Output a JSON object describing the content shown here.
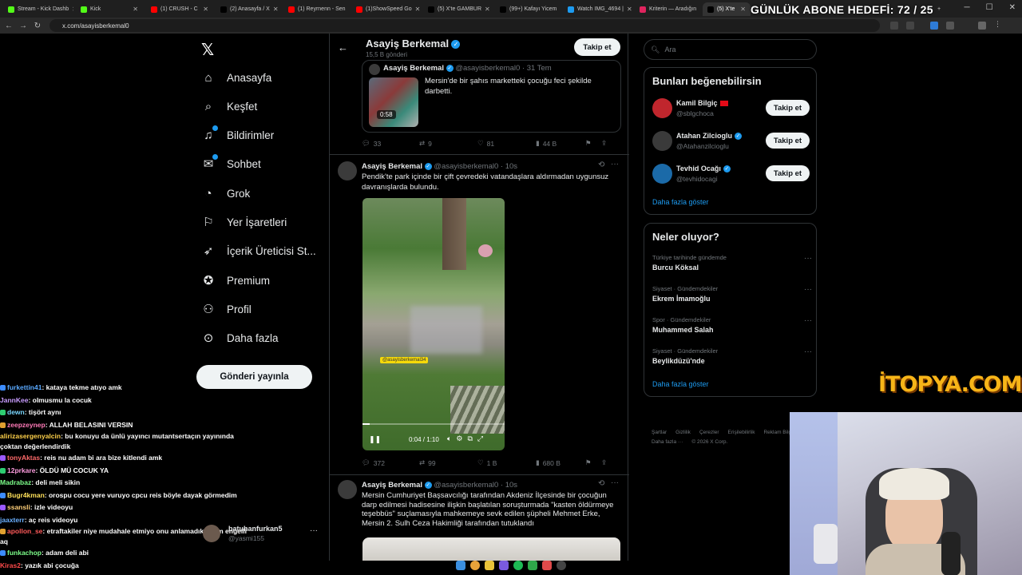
{
  "browser": {
    "tabs": [
      {
        "label": "Stream - Kick Dashb",
        "color": "#53fc18"
      },
      {
        "label": "Kick",
        "color": "#53fc18"
      },
      {
        "label": "(1) CRUSH - C",
        "color": "#ff0000"
      },
      {
        "label": "(2) Anasayfa / X",
        "color": "#000000"
      },
      {
        "label": "(1) Reyrnenn - Sen",
        "color": "#ff0000"
      },
      {
        "label": "(1)ShowSpeed Go",
        "color": "#ff0000"
      },
      {
        "label": "(5) X'te GAMBUR",
        "color": "#000000"
      },
      {
        "label": "(99+) Kafayı Yicem",
        "color": "#000000"
      },
      {
        "label": "Watch IMG_4694 |",
        "color": "#1d9bf0"
      },
      {
        "label": "Kriterin — Aradığın",
        "color": "#e0245e"
      },
      {
        "label": "(5) X'te",
        "color": "#000000"
      }
    ],
    "url": "x.com/asayisberkemal0"
  },
  "overlay": {
    "goal": "GÜNLÜK ABONE HEDEFİ: 72 / 25",
    "sponsor": "İTOPYA.COM"
  },
  "nav": {
    "items": [
      {
        "label": "Anasayfa",
        "icon": "home-icon"
      },
      {
        "label": "Keşfet",
        "icon": "search-icon"
      },
      {
        "label": "Bildirimler",
        "icon": "bell-icon"
      },
      {
        "label": "Sohbet",
        "icon": "chat-icon"
      },
      {
        "label": "Grok",
        "icon": "grok-icon"
      },
      {
        "label": "Yer İşaretleri",
        "icon": "bookmark-icon"
      },
      {
        "label": "İçerik Üreticisi St...",
        "icon": "rocket-icon"
      },
      {
        "label": "Premium",
        "icon": "verified-icon"
      },
      {
        "label": "Profil",
        "icon": "person-icon"
      },
      {
        "label": "Daha fazla",
        "icon": "more-icon"
      }
    ],
    "post_button": "Gönderi yayınla",
    "account": {
      "name": "batuhanfurkan5",
      "handle": "@yasmi155"
    }
  },
  "chat": [
    {
      "user": "furkettin41",
      "color": "#5aa9ff",
      "msg": ": kataya tekme atıyo amk"
    },
    {
      "user": "JannKee",
      "color": "#c89cff",
      "msg": ": olmusmu la cocuk"
    },
    {
      "user": "dewn",
      "color": "#7ad7ff",
      "msg": ": tişört aynı"
    },
    {
      "user": "zeepzeynep",
      "color": "#ff7ab8",
      "msg": ": ALLAH BELASINI VERSIN"
    },
    {
      "user": "alirizasergenyalcin",
      "color": "#ffd14a",
      "msg": ": bu konuyu da ünlü yayıncı mutantsertaçın yayınında çoktan değerlendirdik"
    },
    {
      "user": "tonyAktas",
      "color": "#ff6a6a",
      "msg": ": reis nu adam bi ara bize kitlendi amk"
    },
    {
      "user": "12prkare",
      "color": "#ff9de0",
      "msg": ": ÖLDÜ MÜ COCUK YA"
    },
    {
      "user": "Madrabaz",
      "color": "#7dff8a",
      "msg": ": deli meli sikin"
    },
    {
      "user": "Bugr4kman",
      "color": "#ffe15a",
      "msg": ": orospu cocu yere vuruyo cpcu reis böyle dayak görmedim"
    },
    {
      "user": "ssansli",
      "color": "#ffd07a",
      "msg": ": izle videoyu"
    },
    {
      "user": "jaaxterr",
      "color": "#6ab0ff",
      "msg": ": aç reis videoyu"
    },
    {
      "user": "apollon_se",
      "color": "#ff5a5a",
      "msg": ": etraftakiler niye mudahale etmiyo onu anlamadık adam engelli aq"
    },
    {
      "user": "funkachop",
      "color": "#7dff8a",
      "msg": ": adam deli abi"
    },
    {
      "user": "Kiras2",
      "color": "#ff4a4a",
      "msg": ": yazık abi çocuğa"
    }
  ],
  "profile": {
    "name": "Asayiş Berkemal",
    "posts_count": "15,5 B gönderi",
    "follow_label": "Takip et"
  },
  "tweets": [
    {
      "quoted": {
        "author": "Asayiş Berkemal",
        "handle": "@asayisberkemal0 · 31 Tem",
        "text": "Mersin'de bir şahıs marketteki çocuğu feci şekilde darbetti.",
        "duration": "0:58"
      },
      "stats": {
        "replies": "33",
        "reposts": "9",
        "likes": "81",
        "views": "44 B"
      }
    },
    {
      "author": "Asayiş Berkemal",
      "handle": "@asayisberkemal0 · 10s",
      "text": "Pendik'te park içinde bir çift çevredeki vatandaşlara aldırmadan uygunsuz davranışlarda bulundu.",
      "video": {
        "time": "0:04 / 1:10",
        "watermark": "@asayisberkemal34"
      },
      "stats": {
        "replies": "372",
        "reposts": "99",
        "likes": "1 B",
        "views": "680 B"
      }
    },
    {
      "author": "Asayiş Berkemal",
      "handle": "@asayisberkemal0 · 10s",
      "text": "Mersin Cumhuriyet Başsavcılığı tarafından Akdeniz İlçesinde bir çocuğun darp edilmesi hadisesine ilişkin başlatılan soruşturmada \"kasten öldürmeye teşebbüs\" suçlamasıyla mahkemeye sevk edilen şüpheli Mehmet Erke, Mersin 2. Sulh Ceza Hakimliği tarafından tutuklandı"
    }
  ],
  "right": {
    "search_placeholder": "Ara",
    "suggest_title": "Bunları beğenebilirsin",
    "suggestions": [
      {
        "name": "Kamil Bilgiç",
        "handle": "@sblgchoca",
        "avatar_color": "#c0262d",
        "flag": true,
        "verified": false
      },
      {
        "name": "Atahan Zilcioglu",
        "handle": "@Atahanzilcioglu",
        "avatar_color": "#3a3a3a",
        "flag": false,
        "verified": true
      },
      {
        "name": "Tevhid Ocağı",
        "handle": "@tevhidocagi",
        "avatar_color": "#1b6aa8",
        "flag": false,
        "verified": true
      }
    ],
    "follow_label": "Takip et",
    "show_more": "Daha fazla göster",
    "trends_title": "Neler oluyor?",
    "trends": [
      {
        "category": "Türkiye tarihinde gündemde",
        "name": "Burcu Köksal"
      },
      {
        "category": "Siyaset · Gündemdekiler",
        "name": "Ekrem İmamoğlu"
      },
      {
        "category": "Spor · Gündemdekiler",
        "name": "Muhammed Salah"
      },
      {
        "category": "Siyaset · Gündemdekiler",
        "name": "Beylikdüzü'nde"
      }
    ],
    "footer": [
      "Şartlar",
      "Gizlilik",
      "Çerezler",
      "Erişilebilirlik",
      "Reklam Bilgileri",
      "Daha fazla ···",
      "© 2026 X Corp."
    ]
  }
}
